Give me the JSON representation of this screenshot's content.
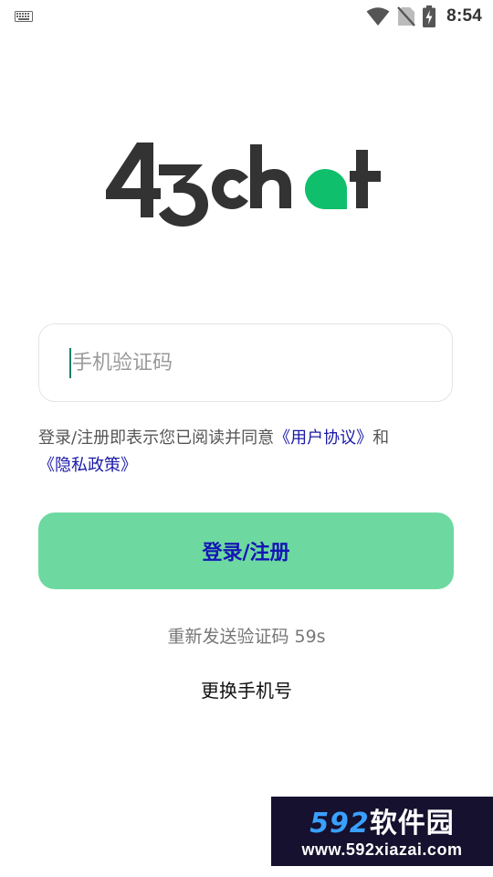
{
  "status_bar": {
    "time": "8:54",
    "icons": [
      "keyboard-icon",
      "wifi-icon",
      "no-sim-icon",
      "battery-charging-icon"
    ]
  },
  "logo": {
    "text": "43chat",
    "colors": {
      "dark": "#333333",
      "accent": "#0fbf6b"
    }
  },
  "code_input": {
    "placeholder": "手机验证码",
    "value": ""
  },
  "agreement": {
    "prefix": "登录/注册即表示您已阅读并同意",
    "user_agreement_link": "《用户协议》",
    "conjunction": "和",
    "privacy_policy_link": "《隐私政策》"
  },
  "login_button": {
    "label": "登录/注册",
    "background": "#6dd9a0"
  },
  "resend": {
    "label": "重新发送验证码 59s"
  },
  "change_phone": {
    "label": "更换手机号"
  },
  "watermark": {
    "number": "592",
    "name": "软件园",
    "url": "www.592xiazai.com"
  }
}
